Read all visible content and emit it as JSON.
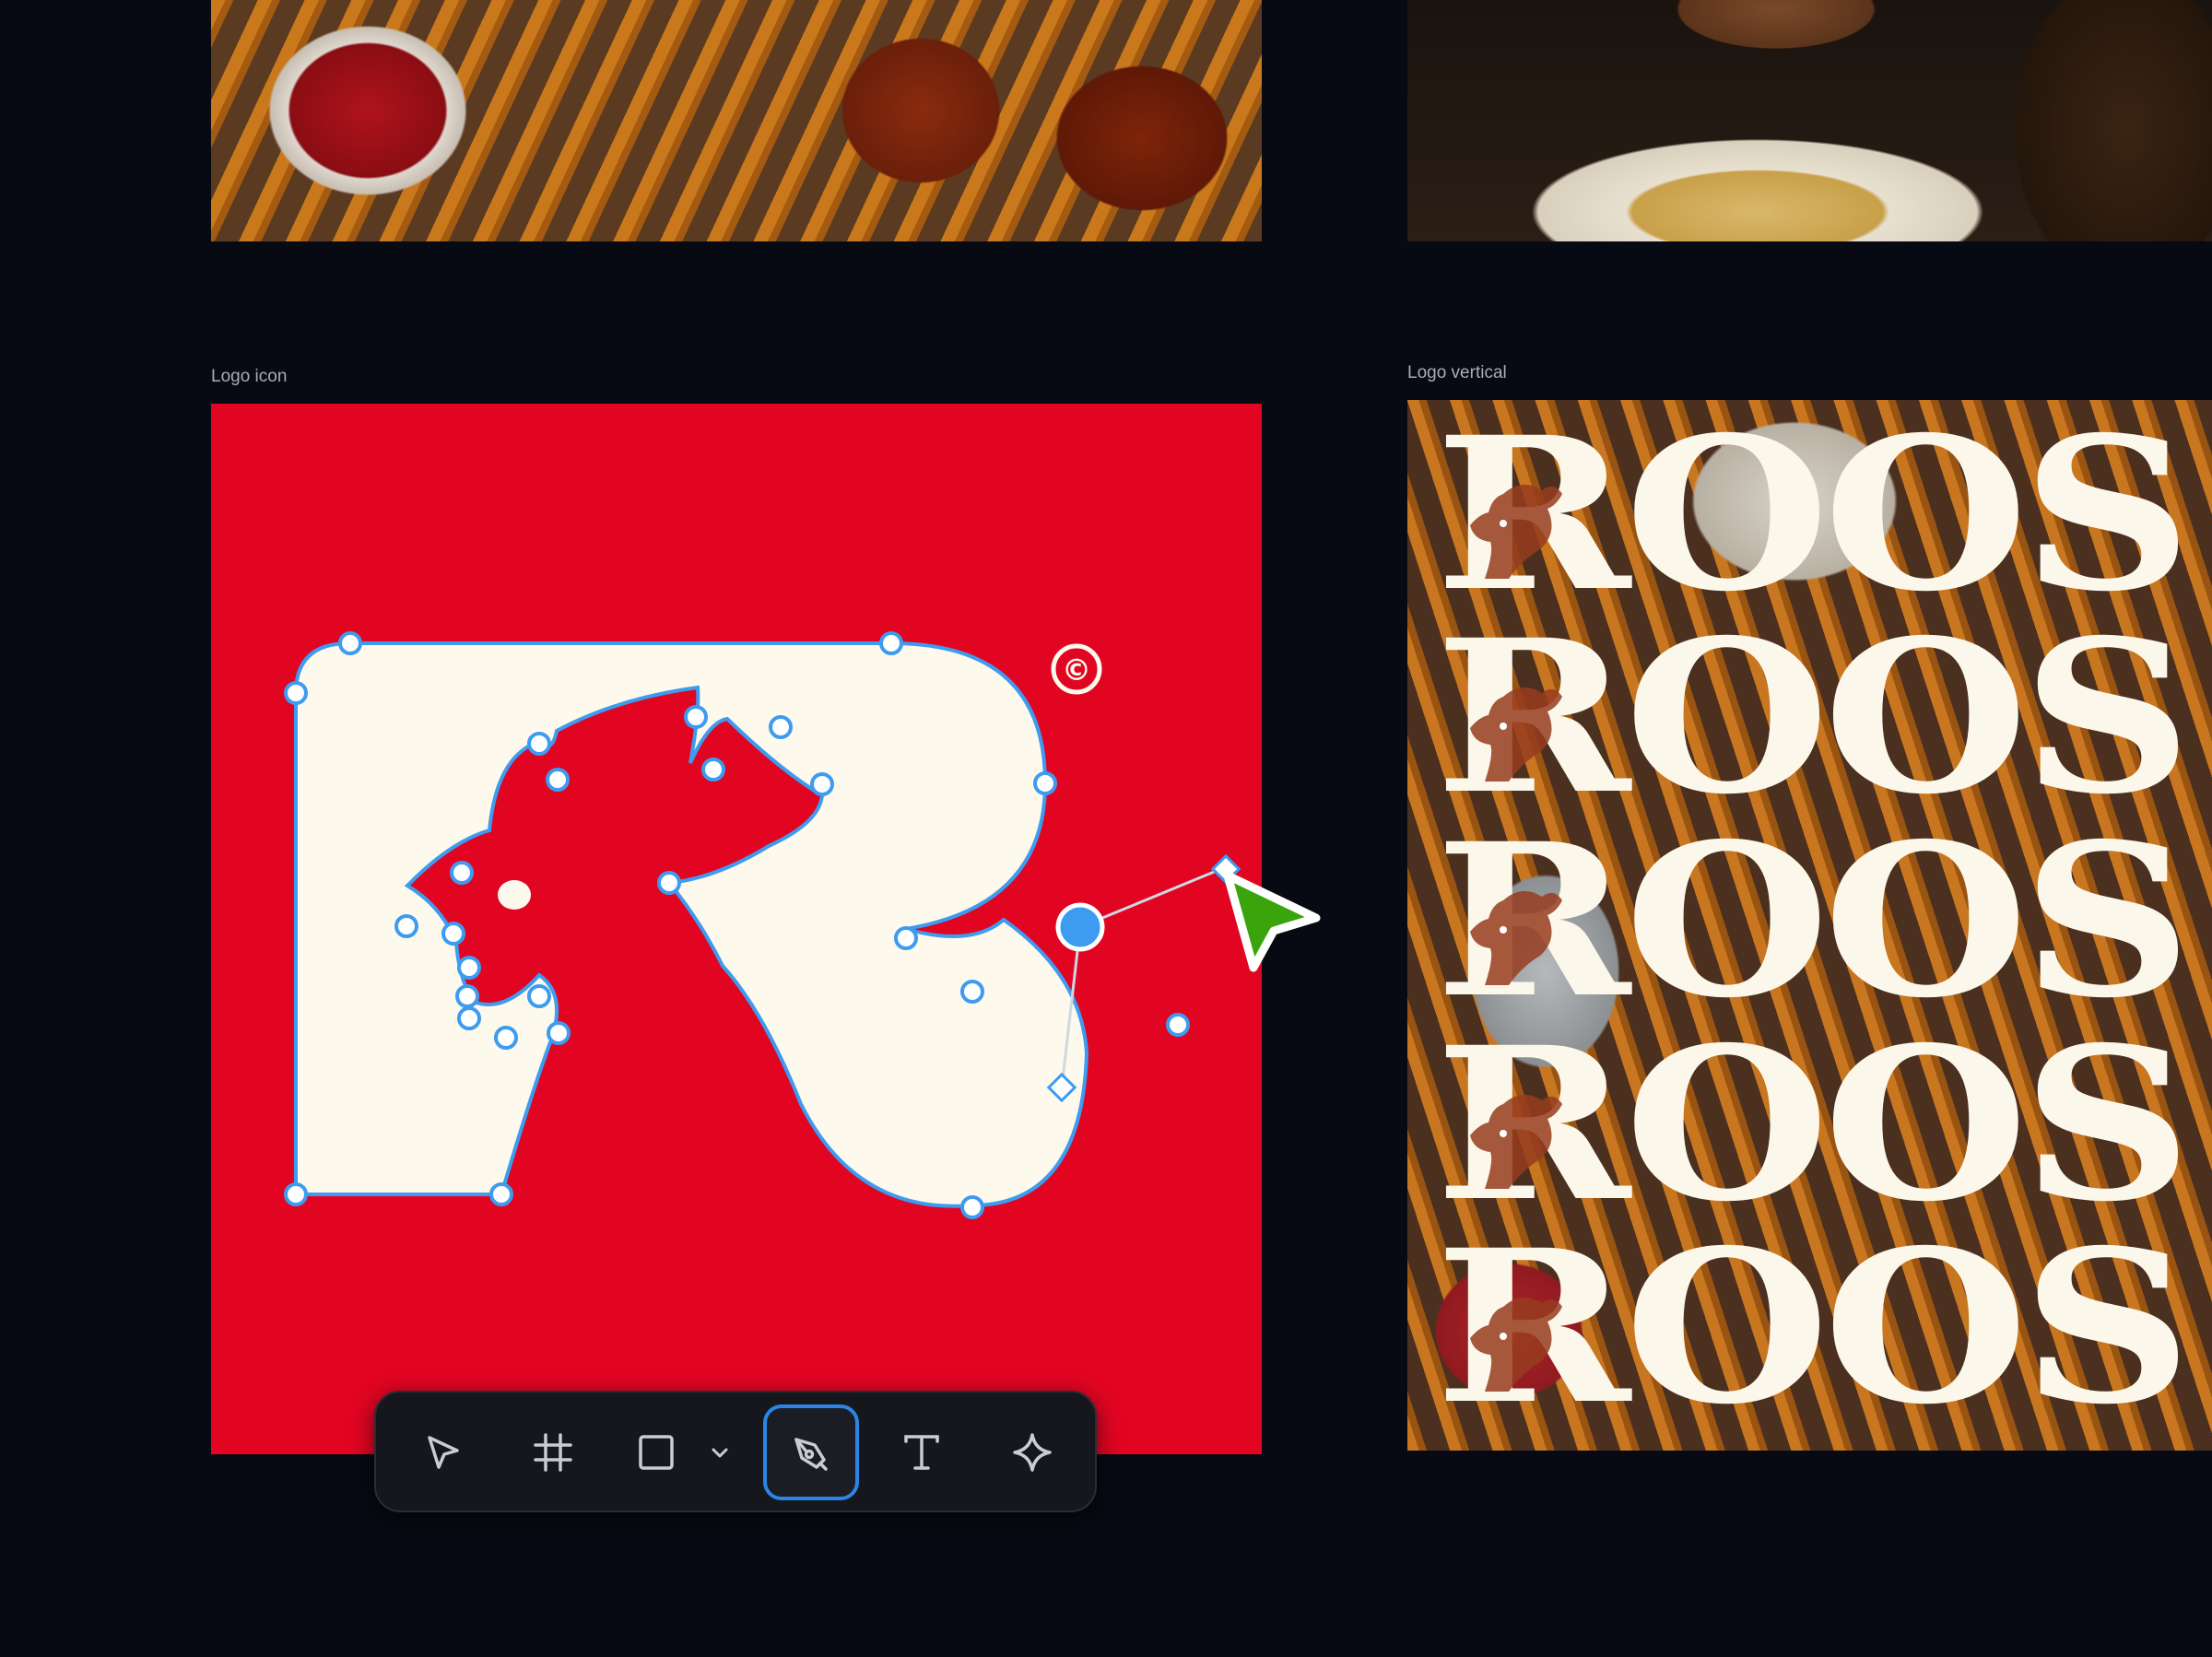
{
  "canvas": {
    "background": "#070a12"
  },
  "frames": {
    "logo_icon": {
      "label": "Logo icon",
      "background": "#e10522"
    },
    "logo_vertical": {
      "label": "Logo vertical",
      "word": "ROOS",
      "rows": 5
    }
  },
  "logo": {
    "copyright_symbol": "©",
    "fill": "#fdf9ec",
    "path_stroke": "#3d9bf0",
    "cursor_color": "#3aa40c"
  },
  "toolbar": {
    "tools": [
      {
        "name": "move",
        "icon": "pointer-icon",
        "active": false
      },
      {
        "name": "frame",
        "icon": "frame-hash-icon",
        "active": false
      },
      {
        "name": "shape",
        "icon": "rectangle-icon",
        "active": false
      },
      {
        "name": "shape-options",
        "icon": "chevron-down-icon",
        "active": false
      },
      {
        "name": "pen",
        "icon": "pen-tool-icon",
        "active": true
      },
      {
        "name": "text",
        "icon": "text-icon",
        "active": false
      },
      {
        "name": "ai",
        "icon": "sparkle-icon",
        "active": false
      }
    ],
    "active_color": "#2a86e6"
  }
}
